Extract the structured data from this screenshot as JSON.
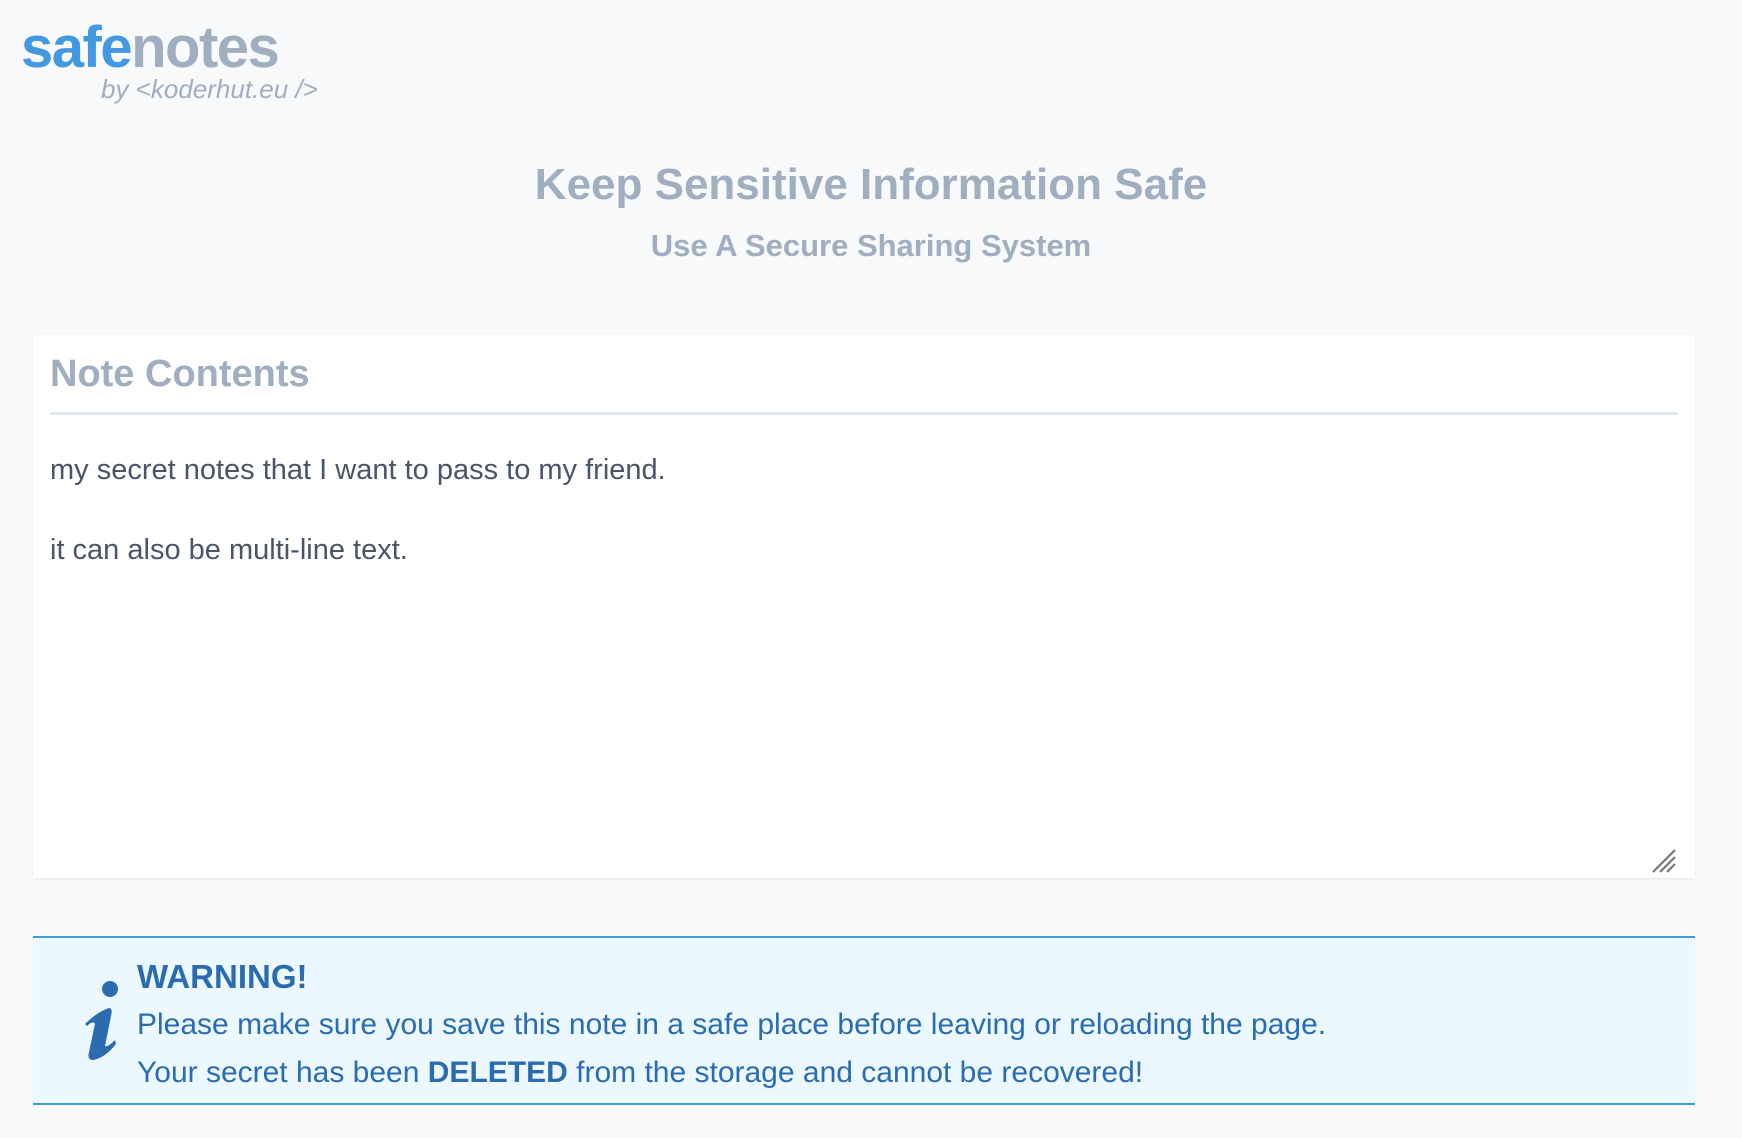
{
  "logo": {
    "part1": "safe",
    "part2": "notes",
    "byline": "by <koderhut.eu />"
  },
  "hero": {
    "title": "Keep Sensitive Information Safe",
    "subtitle": "Use A Secure Sharing System"
  },
  "note": {
    "heading": "Note Contents",
    "content": "my secret notes that I want to pass to my friend.\n\nit can also be multi-line text."
  },
  "alert": {
    "icon": "info-icon",
    "title": "WARNING!",
    "line1": "Please make sure you save this note in a safe place before leaving or reloading the page.",
    "line2_pre": "Your secret has been ",
    "line2_bold": "DELETED",
    "line2_post": " from the storage and cannot be recovered!"
  },
  "colors": {
    "brand": "#4299e1",
    "muted": "#a0aec0",
    "alert_text": "#2b6cb0",
    "alert_bg": "#ebf8ff"
  }
}
